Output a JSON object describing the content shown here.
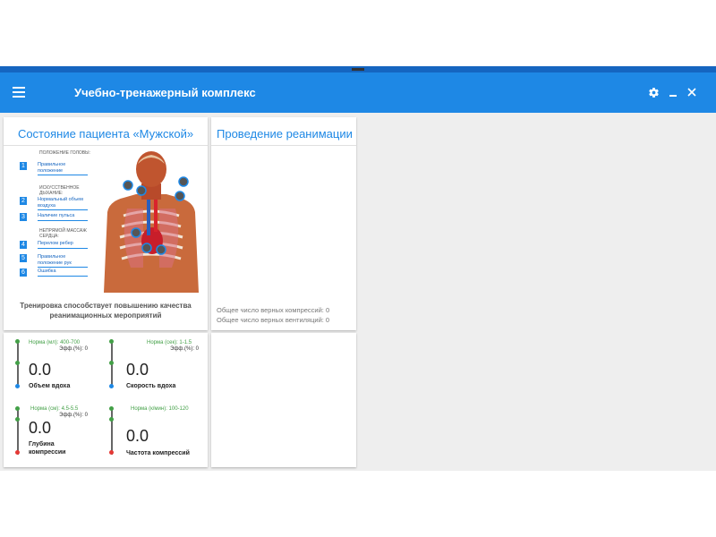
{
  "app": {
    "title": "Учебно-тренажерный комплекс",
    "accent": "#1e88e5",
    "icons": [
      "menu-icon",
      "gear-icon",
      "minimize-icon",
      "close-icon"
    ]
  },
  "patient": {
    "title": "Состояние пациента «Мужской»",
    "legend": {
      "head_header": "ПОЛОЖЕНИЕ ГОЛОВЫ:",
      "breath_header": "ИСКУССТВЕННОЕ ДЫХАНИЕ:",
      "massage_header": "НЕПРЯМОЙ МАССАЖ СЕРДЦА:",
      "items": [
        {
          "num": "1",
          "label": "Правильное положение"
        },
        {
          "num": "2",
          "label": "Нормальный объем воздуха"
        },
        {
          "num": "3",
          "label": "Наличие пульса"
        },
        {
          "num": "4",
          "label": "Перелом ребер"
        },
        {
          "num": "5",
          "label": "Правильное положение рук"
        },
        {
          "num": "6",
          "label": "Ошибка"
        }
      ]
    },
    "caption": "Тренировка способствует повышению качества реанимационных мероприятий"
  },
  "resuscitation": {
    "title": "Проведение реанимации",
    "compressions_text": "Общее число верных компрессий: 0",
    "ventilations_text": "Общее число верных вентиляций: 0"
  },
  "metrics": [
    {
      "norm": "Норма (мл): 400-700",
      "eff": "Эфф.(%): 0",
      "value": "0.0",
      "label": "Объем вдоха"
    },
    {
      "norm": "Норма (сек): 1-1.5",
      "eff": "Эфф.(%): 0",
      "value": "0.0",
      "label": "Скорость вдоха"
    },
    {
      "norm": "Норма (см): 4.5-5.5",
      "eff": "Эфф.(%): 0",
      "value": "0.0",
      "label": "Глубина компрессии"
    },
    {
      "norm": "Норма (к/мин): 100-120",
      "eff": "",
      "value": "0.0",
      "label": "Частота компрессий"
    }
  ]
}
